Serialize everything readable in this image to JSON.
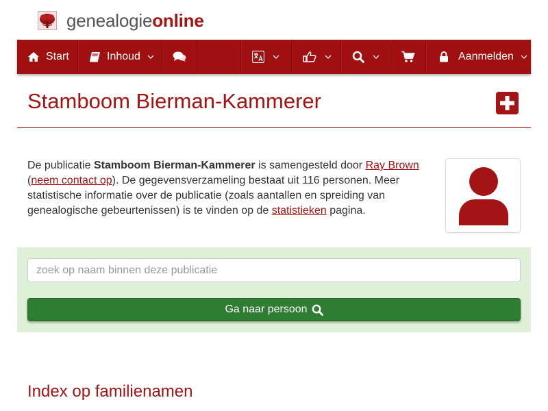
{
  "logo": {
    "name_light": "genealogie",
    "name_strong": "online",
    "icon": "tree-logo-icon"
  },
  "nav": {
    "start": {
      "label": "Start",
      "icon": "home-icon"
    },
    "inhoud": {
      "label": "Inhoud",
      "icon": "book-icon"
    },
    "forum": {
      "icon": "comments-icon"
    },
    "language": {
      "icon": "language-icon"
    },
    "like": {
      "icon": "thumbs-up-icon"
    },
    "search": {
      "icon": "search-icon"
    },
    "cart": {
      "icon": "cart-icon"
    },
    "login": {
      "label": "Aanmelden",
      "icon": "lock-icon"
    }
  },
  "page": {
    "title": "Stamboom Bierman-Kammerer",
    "add_icon": "plus-square-icon"
  },
  "intro": {
    "t1": "De publicatie ",
    "pub_name": "Stamboom Bierman-Kammerer",
    "t2": " is samengesteld door ",
    "author": "Ray Brown",
    "t3": "(",
    "contact": "neem contact op",
    "t4": "). De gegevensverzameling bestaat uit 116 personen. Meer statistische informatie over de publicatie (zoals aantallen en spreiding van genealogische gebeurtenissen) is te vinden op de ",
    "stats": "statistieken",
    "t5": " pagina."
  },
  "search": {
    "placeholder": "zoek op naam binnen deze publicatie",
    "value": "",
    "button_label": "Ga naar persoon",
    "button_icon": "search-icon"
  },
  "sections": {
    "surname_index": "Index op familienamen"
  },
  "colors": {
    "brand_red": "#a01010",
    "search_bg": "#dff0d8",
    "button_green": "#2e7d32"
  }
}
